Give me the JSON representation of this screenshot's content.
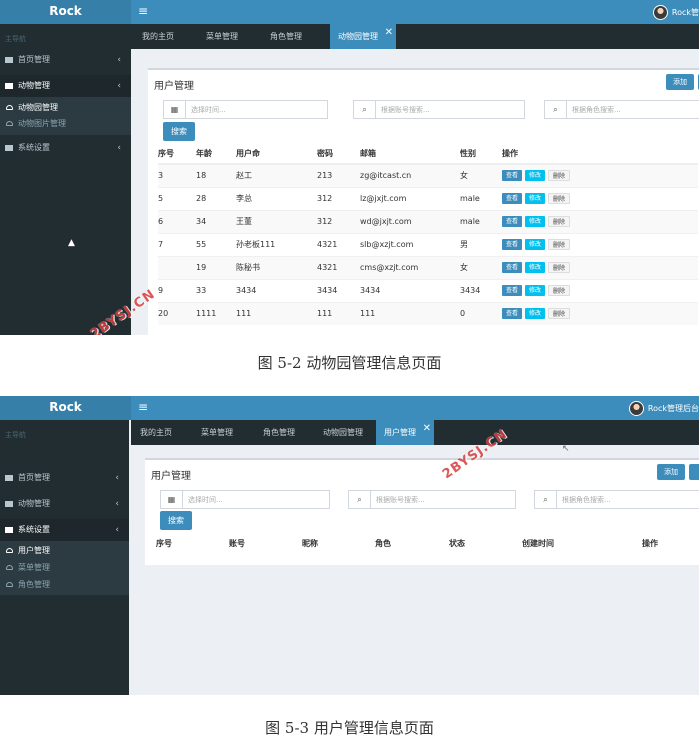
{
  "brand": "Rock",
  "user_name": "Rock管理后台",
  "nav_header": "主导航",
  "watermark": "2BYSJ.CN",
  "screens": [
    {
      "tabs": [
        "我的主页",
        "菜单管理",
        "角色管理",
        "动物园管理"
      ],
      "active_tab": "动物园管理",
      "user_label": "Rock管",
      "sidebar": {
        "items": [
          "首页管理",
          "动物管理",
          "系统设置"
        ],
        "submenu": [
          "动物园管理",
          "动物图片管理"
        ]
      },
      "panel": {
        "title": "用户管理",
        "add_label": "添加",
        "search_time_placeholder": "选择时间...",
        "search_account_placeholder": "根据账号搜索...",
        "search_role_placeholder": "根据角色搜索...",
        "search_button": "搜索",
        "columns": [
          "序号",
          "年龄",
          "用户命",
          "密码",
          "邮箱",
          "性别",
          "操作"
        ],
        "rows": [
          [
            "3",
            "18",
            "赵工",
            "213",
            "zg@itcast.cn",
            "女"
          ],
          [
            "5",
            "28",
            "李总",
            "312",
            "lz@jxjt.com",
            "male"
          ],
          [
            "6",
            "34",
            "王董",
            "312",
            "wd@jxjt.com",
            "male"
          ],
          [
            "7",
            "55",
            "孙老板111",
            "4321",
            "slb@xzjt.com",
            "男"
          ],
          [
            "",
            "19",
            "陈秘书",
            "4321",
            "cms@xzjt.com",
            "女"
          ],
          [
            "9",
            "33",
            "3434",
            "3434",
            "3434",
            "3434"
          ],
          [
            "20",
            "1111",
            "111",
            "111",
            "111",
            "0"
          ]
        ],
        "actions": [
          "查看",
          "修改",
          "删除"
        ]
      }
    },
    {
      "tabs": [
        "我的主页",
        "菜单管理",
        "角色管理",
        "动物园管理",
        "用户管理"
      ],
      "active_tab": "用户管理",
      "user_label": "Rock管理后台",
      "sidebar": {
        "items": [
          "首页管理",
          "动物管理",
          "系统设置"
        ],
        "submenu": [
          "用户管理",
          "菜单管理",
          "角色管理"
        ]
      },
      "panel": {
        "title": "用户管理",
        "add_label": "添加",
        "search_time_placeholder": "选择时间...",
        "search_account_placeholder": "根据账号搜索...",
        "search_role_placeholder": "根据角色搜索...",
        "search_button": "搜索",
        "columns": [
          "序号",
          "账号",
          "昵称",
          "角色",
          "状态",
          "创建时间",
          "操作"
        ]
      }
    }
  ],
  "captions": [
    "图 5-2 动物园管理信息页面",
    "图 5-3 用户管理信息页面"
  ],
  "colors": {
    "header": "#3c8dbc",
    "logo": "#367fa9",
    "sidebar": "#222d32",
    "edit": "#00c0ef"
  }
}
